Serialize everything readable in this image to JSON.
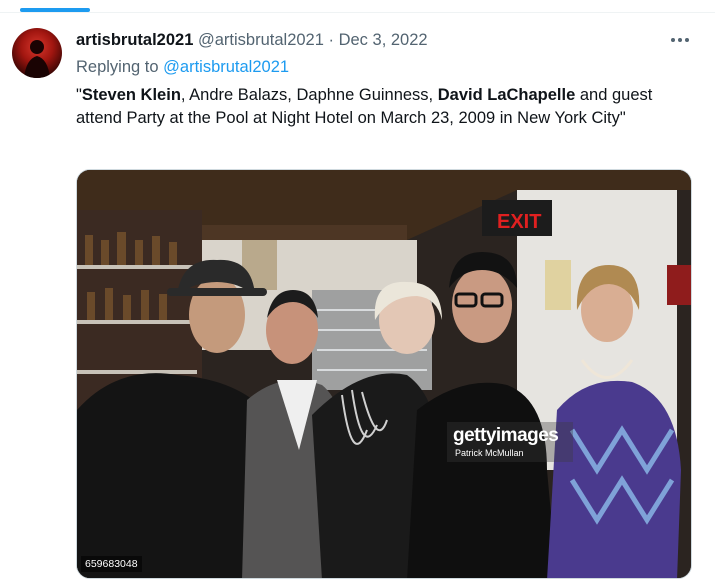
{
  "tweet": {
    "display_name": "artisbrutal2021",
    "handle": "@artisbrutal2021",
    "separator": "·",
    "date": "Dec 3, 2022",
    "replying_prefix": "Replying to",
    "replying_to": "@artisbrutal2021",
    "text": {
      "open_quote": "\"",
      "name1": "Steven Klein",
      "mid1": ", Andre Balazs, Daphne Guinness, ",
      "name2": "David LaChapelle",
      "rest": " and guest attend Party at the Pool at Night Hotel on March 23, 2009 in New York City\""
    }
  },
  "image": {
    "watermark_brand": "gettyimages",
    "watermark_credit": "Patrick McMullan",
    "image_number": "659683048",
    "sign_text": "EXIT"
  },
  "colors": {
    "link": "#1d9bf0",
    "muted": "#536471",
    "text": "#0f1419",
    "accent": "#1d9bf0"
  },
  "icons": {
    "more": "more-horizontal-icon"
  }
}
